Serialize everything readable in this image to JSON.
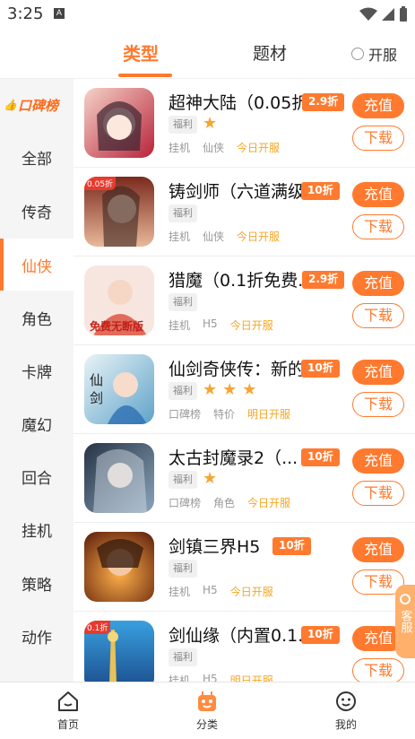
{
  "status_bar": {
    "time": "3:25",
    "a_badge": "A"
  },
  "tabs": {
    "type_label": "类型",
    "theme_label": "题材",
    "open_label": "开服"
  },
  "sidebar": {
    "badge": "口碑榜",
    "categories": [
      "全部",
      "传奇",
      "仙侠",
      "角色",
      "卡牌",
      "魔幻",
      "回合",
      "挂机",
      "策略",
      "动作"
    ],
    "active": "仙侠"
  },
  "games": [
    {
      "title": "超神大陆（0.05折...",
      "discount": "2.9折",
      "fuli": "福利",
      "stars": 1,
      "tags": [
        "挂机",
        "仙侠"
      ],
      "status": "今日开服",
      "charge": "充值",
      "download": "下载",
      "ribbon": ""
    },
    {
      "title": "铸剑师（六道满级...",
      "discount": "10折",
      "fuli": "福利",
      "stars": 0,
      "tags": [
        "挂机",
        "仙侠"
      ],
      "status": "今日开服",
      "charge": "充值",
      "download": "下载",
      "ribbon": "0.05折"
    },
    {
      "title": "猎魔（0.1折免费...",
      "discount": "2.9折",
      "fuli": "福利",
      "stars": 0,
      "tags": [
        "挂机",
        "H5"
      ],
      "status": "今日开服",
      "charge": "充值",
      "download": "下载",
      "ribbon": ""
    },
    {
      "title": "仙剑奇侠传：新的...",
      "discount": "10折",
      "fuli": "福利",
      "stars": 3,
      "tags": [
        "口碑榜",
        "特价"
      ],
      "status": "明日开服",
      "charge": "充值",
      "download": "下载",
      "ribbon": ""
    },
    {
      "title": "太古封魔录2（...",
      "discount": "10折",
      "fuli": "福利",
      "stars": 1,
      "tags": [
        "口碑榜",
        "角色"
      ],
      "status": "今日开服",
      "charge": "充值",
      "download": "下载",
      "ribbon": ""
    },
    {
      "title": "剑镇三界H5",
      "discount": "10折",
      "fuli": "福利",
      "stars": 0,
      "tags": [
        "挂机",
        "H5"
      ],
      "status": "今日开服",
      "charge": "充值",
      "download": "下载",
      "ribbon": ""
    },
    {
      "title": "剑仙缘（内置0.1...",
      "discount": "10折",
      "fuli": "福利",
      "stars": 0,
      "tags": [
        "挂机",
        "H5"
      ],
      "status": "明日开服",
      "charge": "充值",
      "download": "下载",
      "ribbon": "0.1折"
    }
  ],
  "customer_service": "客服",
  "bottom_nav": {
    "home": "首页",
    "category": "分类",
    "mine": "我的"
  },
  "colors": {
    "accent": "#ff7a2e",
    "star": "#f7a530",
    "today": "#f5a623"
  }
}
